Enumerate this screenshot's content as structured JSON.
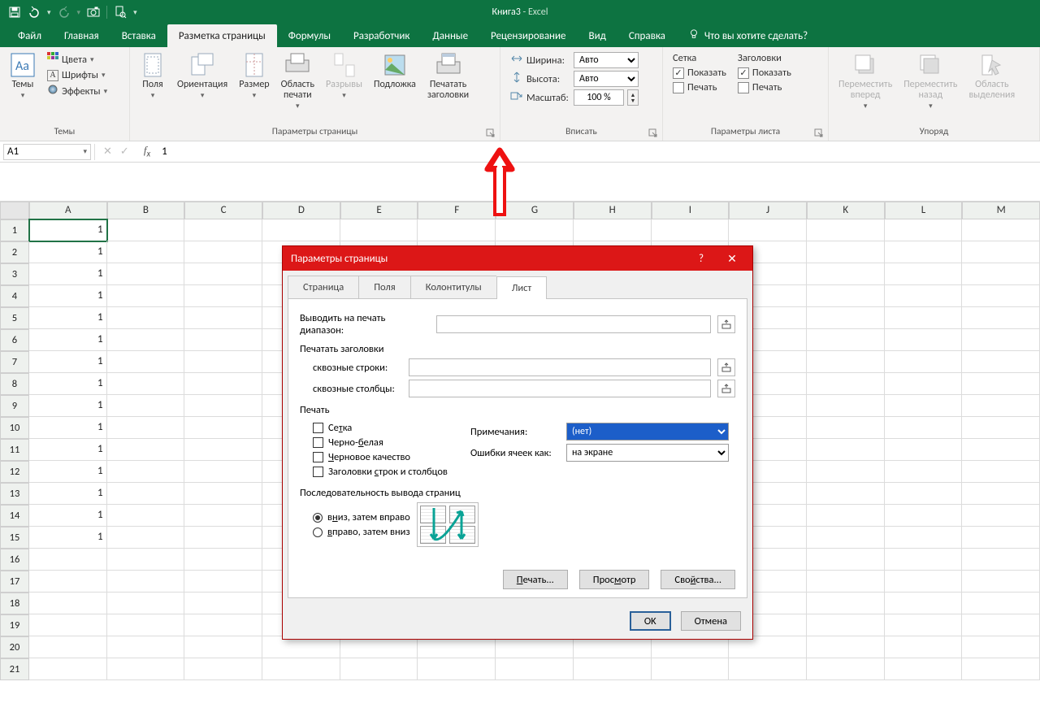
{
  "titlebar": {
    "book": "Книга3",
    "sep": " - ",
    "app": "Excel"
  },
  "tabs": {
    "file": "Файл",
    "home": "Главная",
    "insert": "Вставка",
    "layout": "Разметка страницы",
    "formulas": "Формулы",
    "developer": "Разработчик",
    "data": "Данные",
    "review": "Рецензирование",
    "view": "Вид",
    "help": "Справка",
    "tellme": "Что вы хотите сделать?"
  },
  "ribbon": {
    "themes": {
      "label": "Темы",
      "themes": "Темы",
      "colors": "Цвета",
      "fonts": "Шрифты",
      "effects": "Эффекты"
    },
    "pagesetup": {
      "label": "Параметры страницы",
      "margins": "Поля",
      "orientation": "Ориентация",
      "size": "Размер",
      "printarea": "Область\nпечати",
      "breaks": "Разрывы",
      "background": "Подложка",
      "printtitles": "Печатать\nзаголовки"
    },
    "scale": {
      "label": "Вписать",
      "width": "Ширина:",
      "height": "Высота:",
      "scale": "Масштаб:",
      "width_val": "Авто",
      "height_val": "Авто",
      "scale_val": "100 %"
    },
    "sheetopts": {
      "label": "Параметры листа",
      "grid": "Сетка",
      "headings": "Заголовки",
      "show": "Показать",
      "print": "Печать"
    },
    "arrange": {
      "label": "Упоряд",
      "bringfwd": "Переместить\nвперед",
      "sendback": "Переместить\nназад",
      "selpane": "Область\nвыделения"
    }
  },
  "namebox": "A1",
  "formula": "1",
  "columns": [
    "A",
    "B",
    "C",
    "D",
    "E",
    "F",
    "G",
    "H",
    "I",
    "J",
    "K",
    "L",
    "M"
  ],
  "rows": [
    1,
    2,
    3,
    4,
    5,
    6,
    7,
    8,
    9,
    10,
    11,
    12,
    13,
    14,
    15,
    16,
    17,
    18,
    19,
    20,
    21
  ],
  "colA": [
    "1",
    "1",
    "1",
    "1",
    "1",
    "1",
    "1",
    "1",
    "1",
    "1",
    "1",
    "1",
    "1",
    "1",
    "1",
    "",
    "",
    "",
    "",
    "",
    ""
  ],
  "dialog": {
    "title": "Параметры страницы",
    "tabs": {
      "page": "Страница",
      "margins": "Поля",
      "headerfooter": "Колонтитулы",
      "sheet": "Лист"
    },
    "print_range": "Выводить на печать диапазон:",
    "print_titles": "Печатать заголовки",
    "rows_repeat": "сквозные строки:",
    "cols_repeat": "сквозные столбцы:",
    "print_sect": "Печать",
    "cb_grid": "Сетка",
    "cb_bw": "Черно-белая",
    "cb_draft": "Черновое качество",
    "cb_headings": "Заголовки строк и столбцов",
    "comments": "Примечания:",
    "comments_val": "(нет)",
    "errors": "Ошибки ячеек как:",
    "errors_val": "на экране",
    "order_sect": "Последовательность вывода страниц",
    "order_down": "вниз, затем вправо",
    "order_over": "вправо, затем вниз",
    "btn_print": "Печать...",
    "btn_preview": "Просмотр",
    "btn_options": "Свойства...",
    "ok": "OK",
    "cancel": "Отмена"
  }
}
